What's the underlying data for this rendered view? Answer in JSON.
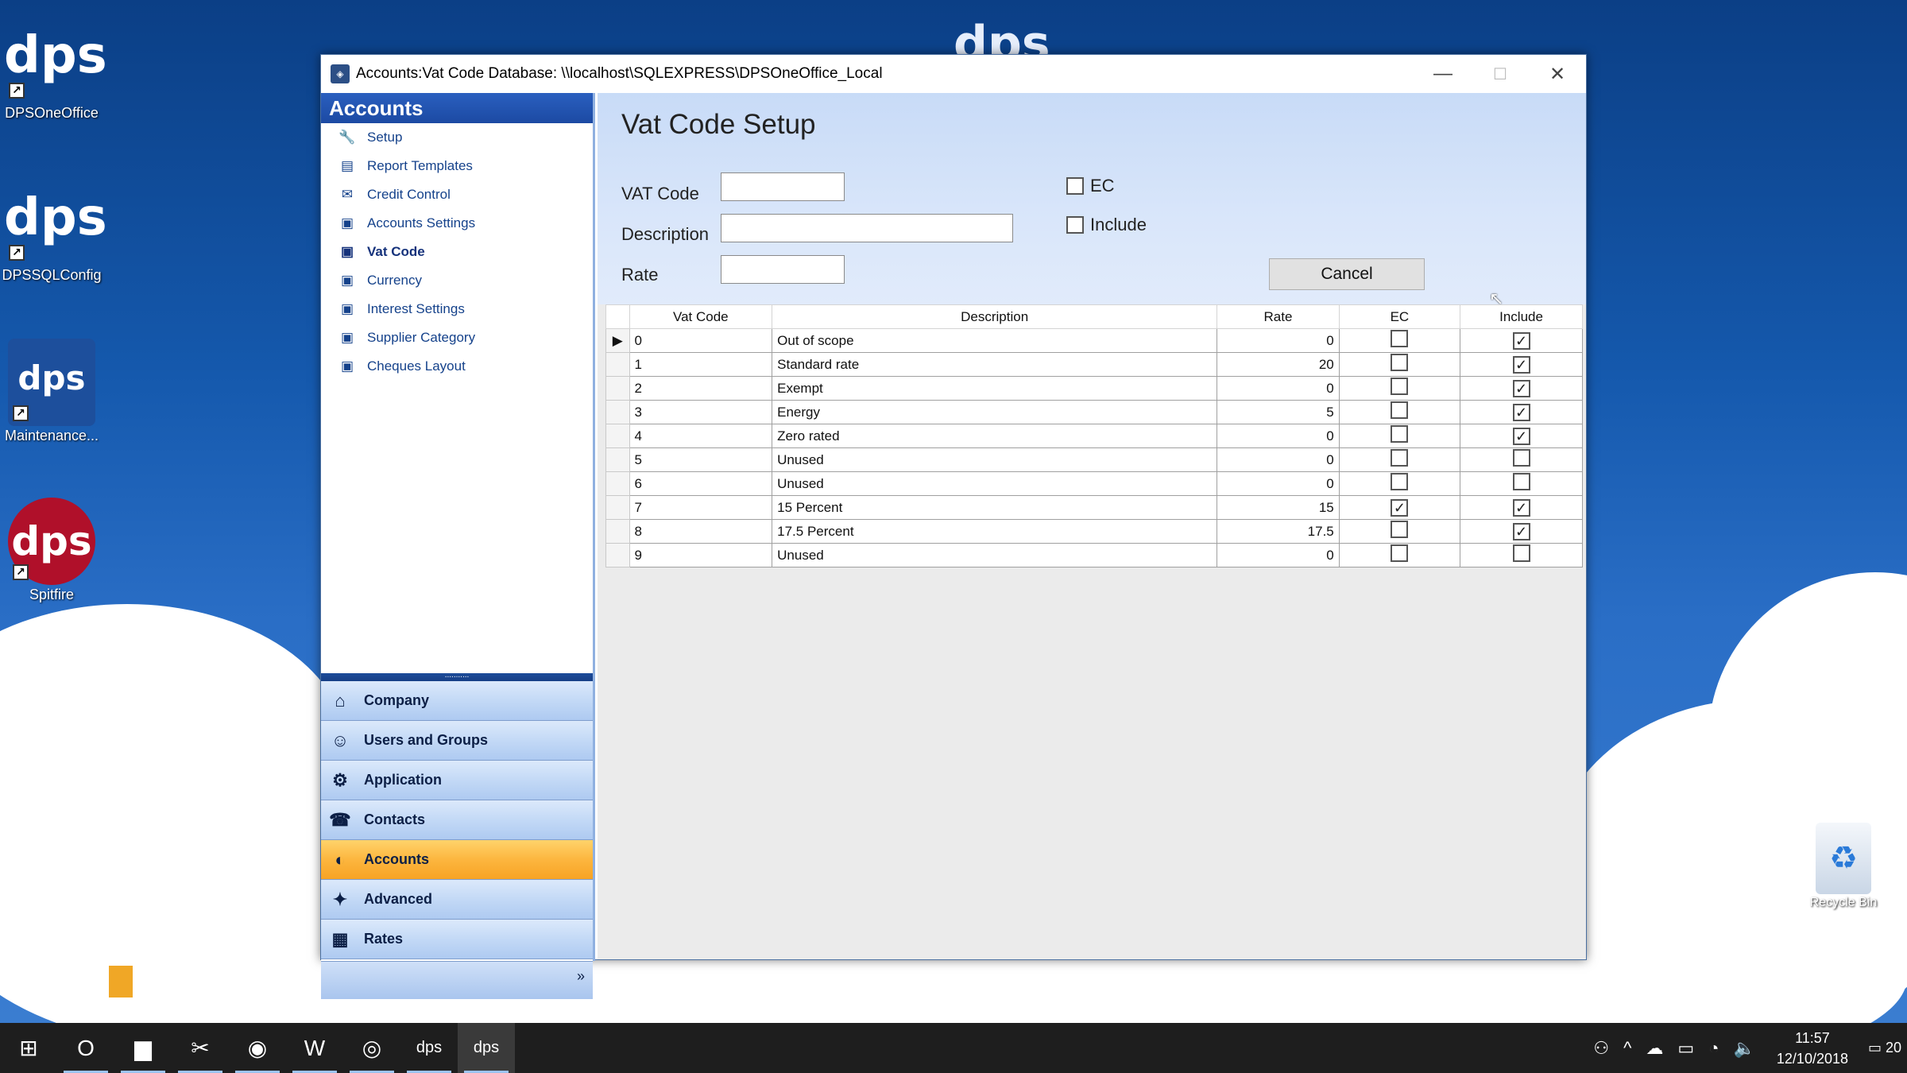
{
  "desktop": {
    "watermark": "dps",
    "icons": [
      {
        "label": "DPSOneOffice",
        "logo": "dps"
      },
      {
        "label": "DPSSQLConfig",
        "logo": "dps"
      },
      {
        "label": "Maintenance...",
        "logo": "dps"
      },
      {
        "label": "Spitfire",
        "logo": "dps"
      }
    ],
    "recycle_bin": "Recycle Bin"
  },
  "window": {
    "title": "Accounts:Vat Code Database: \\\\localhost\\SQLEXPRESS\\DPSOneOffice_Local",
    "minimize": "—",
    "maximize": "☐",
    "close": "✕"
  },
  "nav": {
    "header": "Accounts",
    "items": [
      {
        "label": "Setup",
        "icon": "wrench-icon"
      },
      {
        "label": "Report Templates",
        "icon": "report-icon"
      },
      {
        "label": "Credit Control",
        "icon": "credit-icon"
      },
      {
        "label": "Accounts Settings",
        "icon": "settings-icon"
      },
      {
        "label": "Vat Code",
        "icon": "vat-icon"
      },
      {
        "label": "Currency",
        "icon": "currency-icon"
      },
      {
        "label": "Interest Settings",
        "icon": "interest-icon"
      },
      {
        "label": "Supplier Category",
        "icon": "supplier-icon"
      },
      {
        "label": "Cheques Layout",
        "icon": "cheque-icon"
      }
    ],
    "selected_item": "Vat Code",
    "grip": "...........",
    "groups": [
      {
        "label": "Company",
        "icon": "company-icon"
      },
      {
        "label": "Users and Groups",
        "icon": "users-icon"
      },
      {
        "label": "Application",
        "icon": "application-icon"
      },
      {
        "label": "Contacts",
        "icon": "contacts-icon"
      },
      {
        "label": "Accounts",
        "icon": "accounts-icon"
      },
      {
        "label": "Advanced",
        "icon": "advanced-icon"
      },
      {
        "label": "Rates",
        "icon": "rates-icon"
      }
    ],
    "selected_group": "Accounts",
    "footer_chevron": "»"
  },
  "form": {
    "title": "Vat Code Setup",
    "vat_code_label": "VAT Code",
    "vat_code_value": "",
    "description_label": "Description",
    "description_value": "",
    "rate_label": "Rate",
    "rate_value": "",
    "ec_label": "EC",
    "ec_checked": false,
    "include_label": "Include",
    "include_checked": false,
    "cancel_label": "Cancel"
  },
  "grid": {
    "columns": [
      "Vat Code",
      "Description",
      "Rate",
      "EC",
      "Include"
    ],
    "current_row_marker": "▶",
    "check_mark": "✓",
    "rows": [
      {
        "code": "0",
        "description": "Out of scope",
        "rate": "0",
        "ec": false,
        "include": true
      },
      {
        "code": "1",
        "description": "Standard rate",
        "rate": "20",
        "ec": false,
        "include": true
      },
      {
        "code": "2",
        "description": "Exempt",
        "rate": "0",
        "ec": false,
        "include": true
      },
      {
        "code": "3",
        "description": "Energy",
        "rate": "5",
        "ec": false,
        "include": true
      },
      {
        "code": "4",
        "description": "Zero rated",
        "rate": "0",
        "ec": false,
        "include": true
      },
      {
        "code": "5",
        "description": "Unused",
        "rate": "0",
        "ec": false,
        "include": false
      },
      {
        "code": "6",
        "description": "Unused",
        "rate": "0",
        "ec": false,
        "include": false
      },
      {
        "code": "7",
        "description": "15 Percent",
        "rate": "15",
        "ec": true,
        "include": true
      },
      {
        "code": "8",
        "description": "17.5 Percent",
        "rate": "17.5",
        "ec": false,
        "include": true
      },
      {
        "code": "9",
        "description": "Unused",
        "rate": "0",
        "ec": false,
        "include": false
      }
    ]
  },
  "taskbar": {
    "apps": [
      {
        "name": "start-button",
        "glyph": "⊞"
      },
      {
        "name": "outlook-app",
        "glyph": "O"
      },
      {
        "name": "file-explorer-app",
        "glyph": "▆"
      },
      {
        "name": "snip-app",
        "glyph": "✂"
      },
      {
        "name": "chrome-app",
        "glyph": "◉"
      },
      {
        "name": "word-app",
        "glyph": "W"
      },
      {
        "name": "obs-app",
        "glyph": "◎"
      },
      {
        "name": "dps-app",
        "glyph": "dps"
      },
      {
        "name": "dps-config-app",
        "glyph": "dps"
      }
    ],
    "tray": [
      "⚇",
      "^",
      "☁",
      "▭",
      "◔",
      "🔈"
    ],
    "time": "11:57",
    "date": "12/10/2018",
    "notification_count": "20"
  },
  "colors": {
    "nav_header": "#1c4aa3",
    "selected_group": "#fcb63f",
    "form_bg": "#c8dbf7"
  }
}
